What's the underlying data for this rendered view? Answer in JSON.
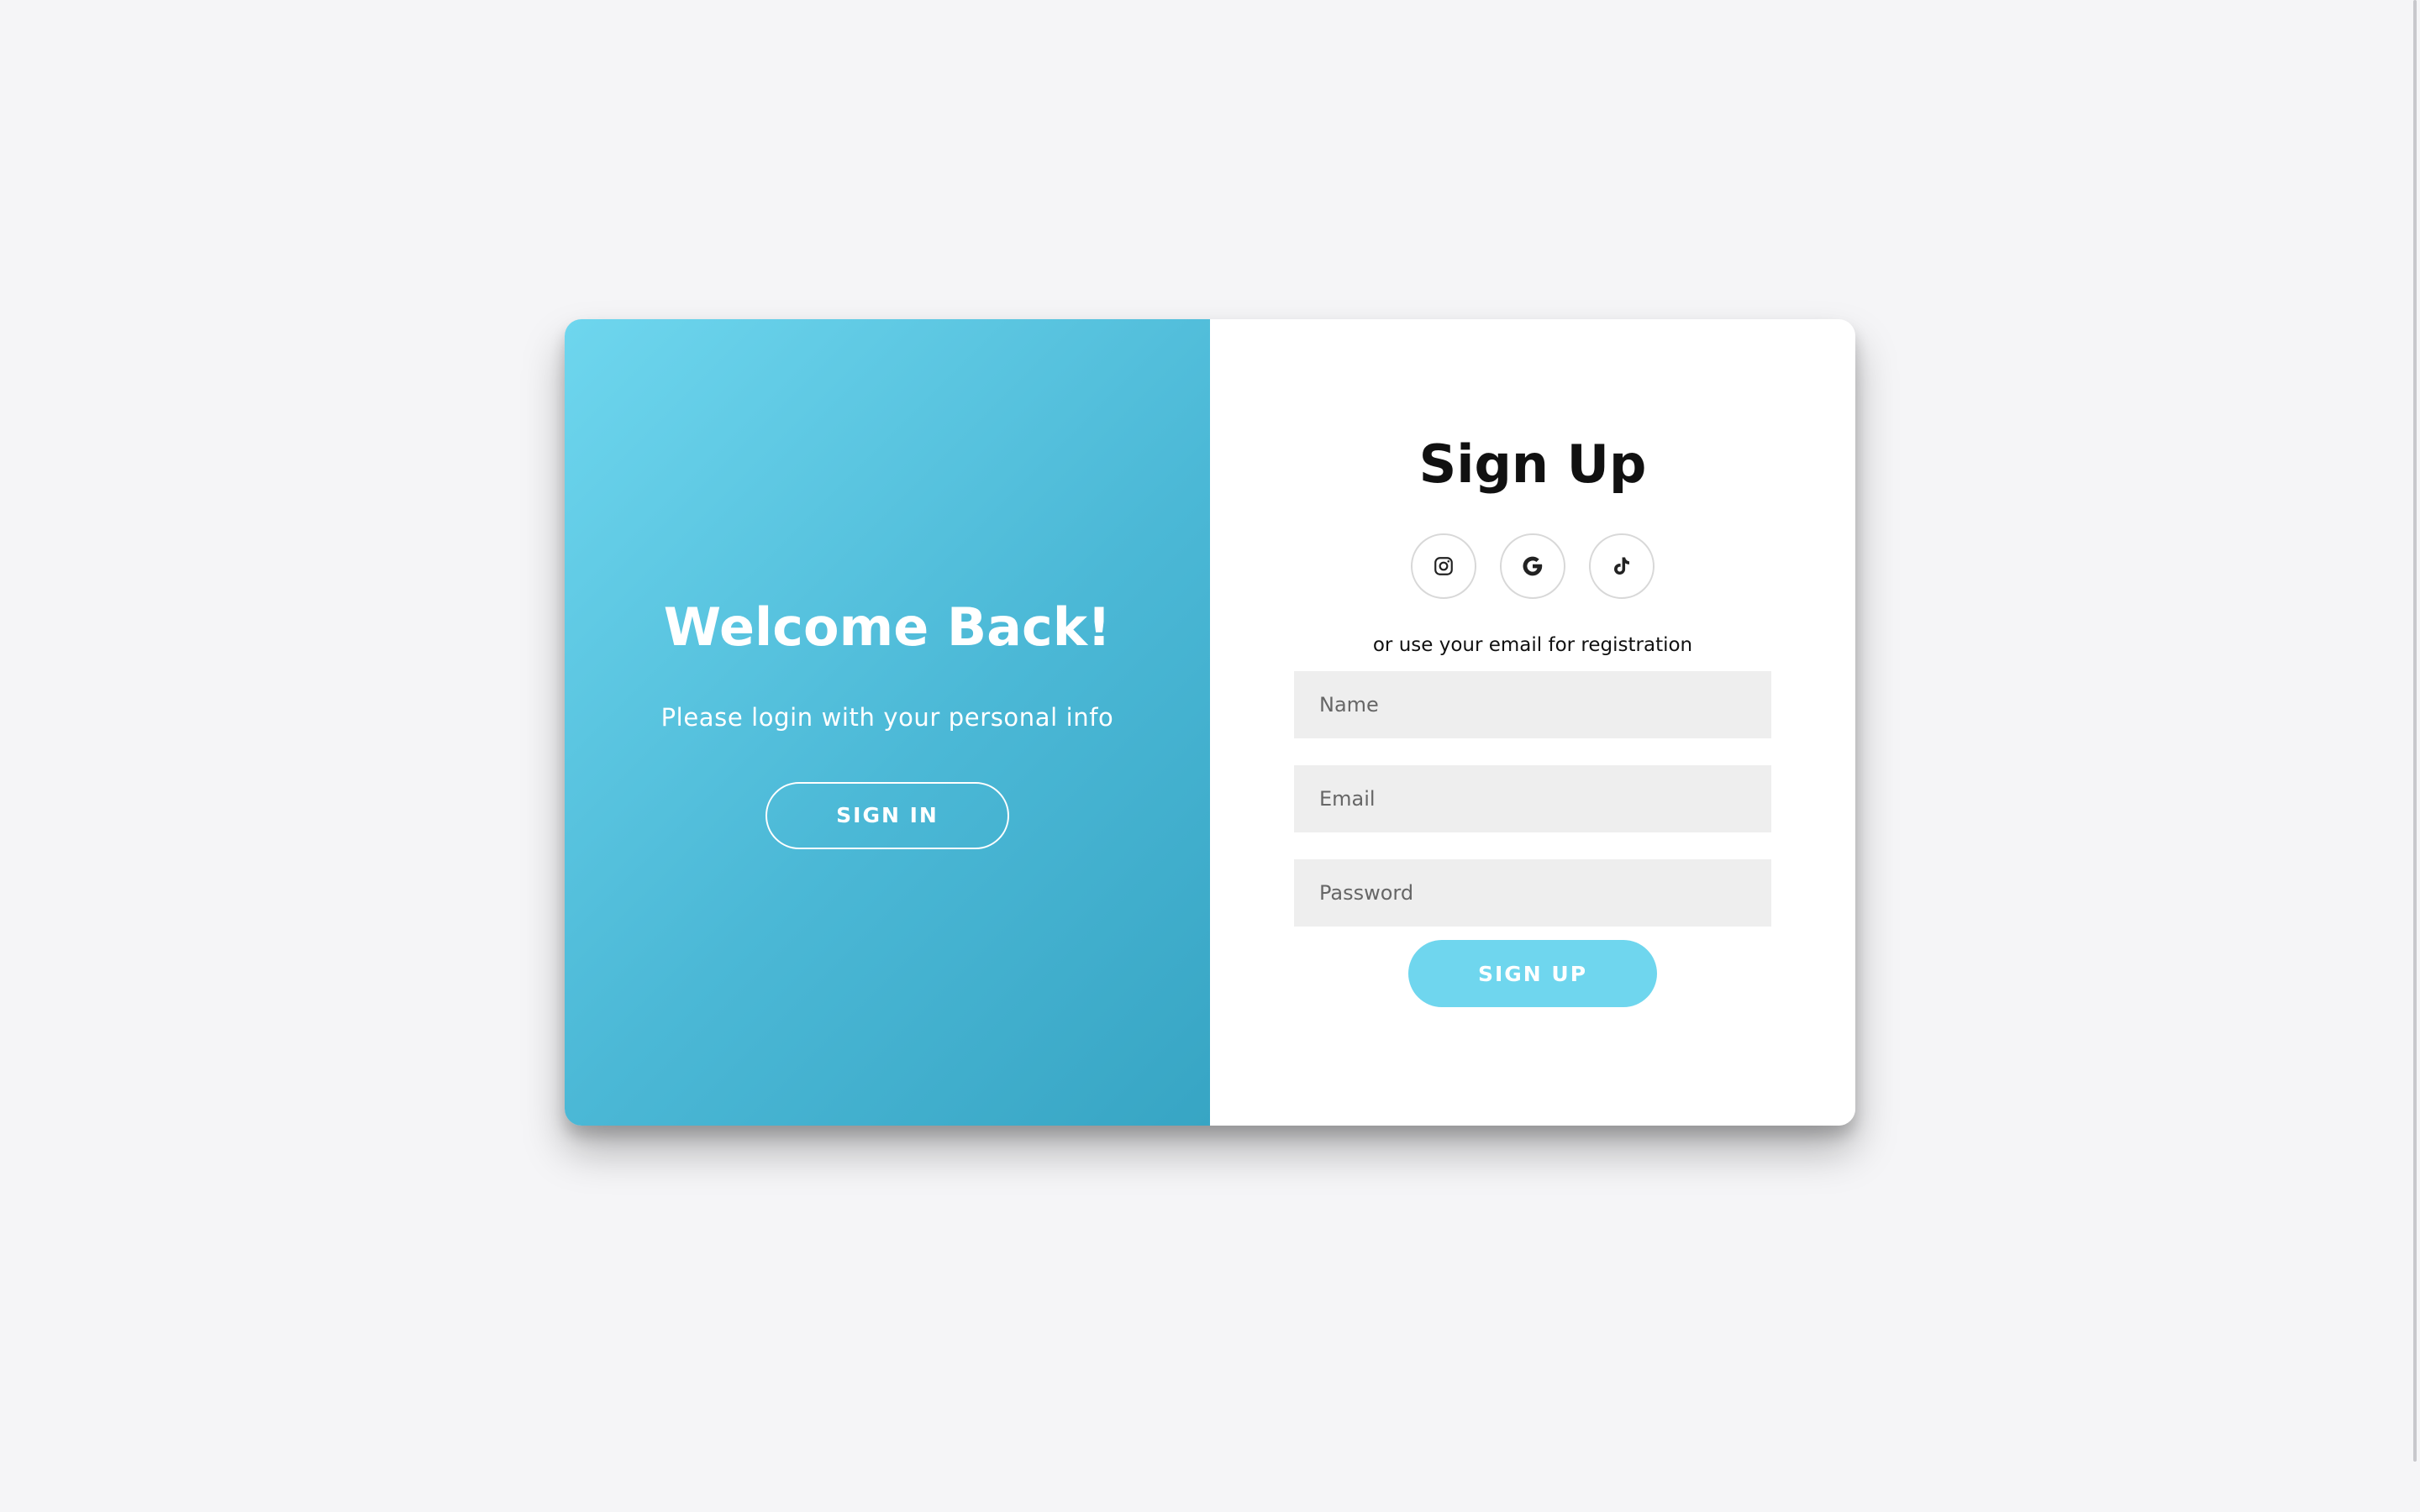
{
  "overlay": {
    "title": "Welcome Back!",
    "text": "Please login with your personal info",
    "button_label": "SIGN IN"
  },
  "form": {
    "title": "Sign Up",
    "social": [
      {
        "icon": "instagram-icon"
      },
      {
        "icon": "google-icon"
      },
      {
        "icon": "tiktok-icon"
      }
    ],
    "hint": "or use your email for registration",
    "fields": {
      "name_placeholder": "Name",
      "email_placeholder": "Email",
      "password_placeholder": "Password"
    },
    "submit_label": "SIGN UP"
  },
  "colors": {
    "page_background": "#f5f5f7",
    "gradient_start": "#6ed6ee",
    "gradient_end": "#37a5c4",
    "accent": "#6fd6ee",
    "input_background": "#eeeeee"
  }
}
